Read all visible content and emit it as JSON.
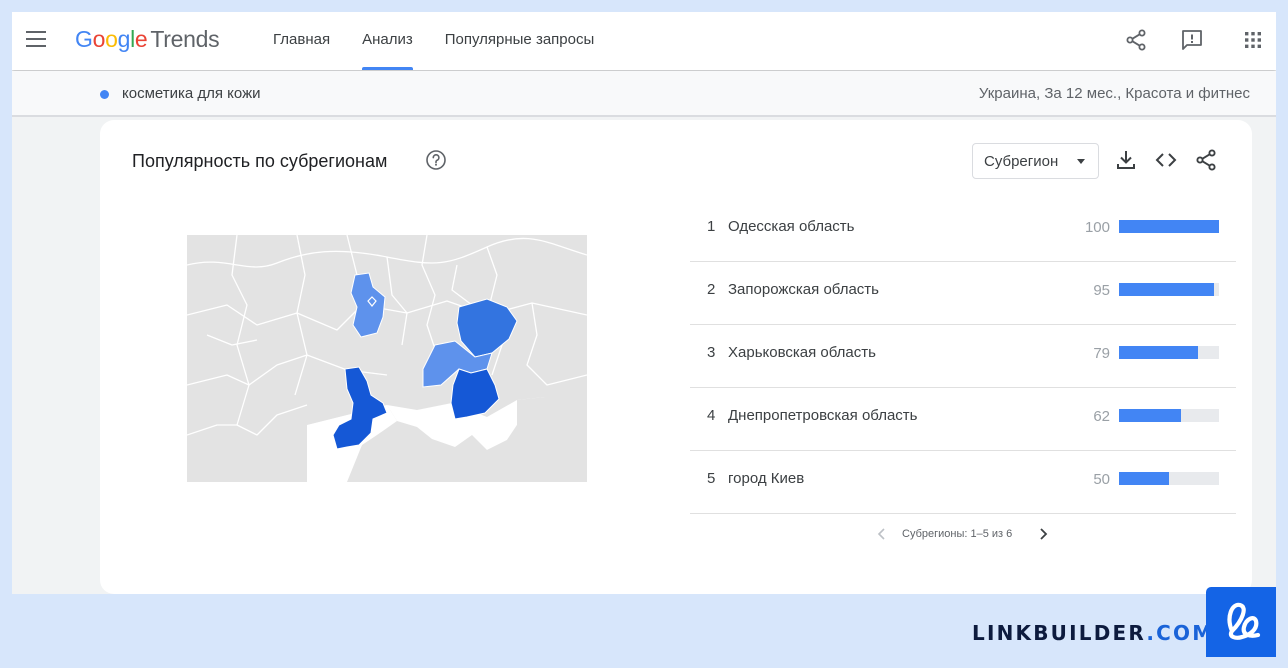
{
  "app": {
    "logo_google": [
      "G",
      "o",
      "o",
      "g",
      "l",
      "e"
    ],
    "logo_trends": "Trends"
  },
  "nav": {
    "items": [
      {
        "label": "Главная",
        "active": false
      },
      {
        "label": "Анализ",
        "active": true
      },
      {
        "label": "Популярные запросы",
        "active": false
      }
    ]
  },
  "icons": {
    "menu": "menu-icon",
    "share": "share-icon",
    "feedback": "feedback-icon",
    "apps": "apps-grid-icon",
    "help": "help-circle-icon",
    "download": "download-icon",
    "embed": "embed-code-icon",
    "card_share": "share-icon",
    "prev": "chevron-left-icon",
    "next": "chevron-right-icon"
  },
  "search": {
    "term": "косметика для кожи",
    "term_color": "#4285f4",
    "filters": "Украина, За 12 мес., Красота и фитнес"
  },
  "card": {
    "title": "Популярность по субрегионам",
    "select_value": "Субрегион"
  },
  "ranking": [
    {
      "rank": "1",
      "name": "Одесская область",
      "value": 100
    },
    {
      "rank": "2",
      "name": "Запорожская область",
      "value": 95
    },
    {
      "rank": "3",
      "name": "Харьковская область",
      "value": 79
    },
    {
      "rank": "4",
      "name": "Днепропетровская область",
      "value": 62
    },
    {
      "rank": "5",
      "name": "город Киев",
      "value": 50
    }
  ],
  "pager": {
    "text": "Субрегионы: 1–5 из 6"
  },
  "brand": {
    "name": "LINKBUILDER",
    "tld": ".COM"
  },
  "colors": {
    "accent": "#4285f4",
    "map_dark": "#1558d6",
    "map_mid": "#3374e0",
    "map_light": "#5e92ec",
    "brand_blue": "#1464e6"
  }
}
